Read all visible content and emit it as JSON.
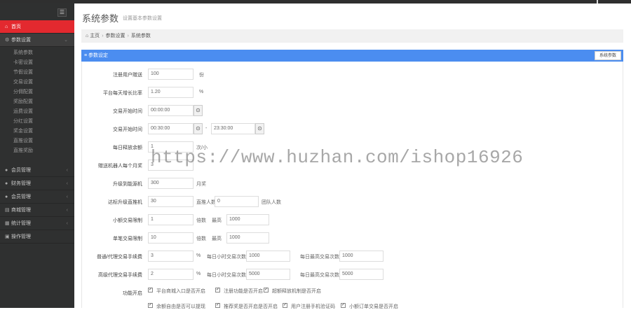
{
  "sidebar": {
    "toggle_icon": "menu-icon",
    "home": "首页",
    "params": "参数设置",
    "sub": [
      "系统参数",
      "卡密设置",
      "节假设置",
      "交易设置",
      "分佣配置",
      "奖励配置",
      "运费设置",
      "分红设置",
      "奖金设置",
      "直推设置",
      "直推奖励"
    ],
    "menus": [
      "会员管理",
      "财务管理",
      "会员管理",
      "商城管理",
      "统计管理",
      "操作管理"
    ]
  },
  "page": {
    "title": "系统参数",
    "subtitle": "设置基本参数设置"
  },
  "breadcrumb": {
    "home": "主页",
    "section": "参数设置",
    "current": "系统参数"
  },
  "panel": {
    "title": "≡ 参数设定",
    "back": "系统参数"
  },
  "form": {
    "r1": {
      "label": "注册用户赠送",
      "value": "100",
      "unit": "份"
    },
    "r2": {
      "label": "平台每天增长比率",
      "value": "1.20",
      "unit": "%"
    },
    "r3": {
      "label": "交易开始时间",
      "value": "00:00:00"
    },
    "r4": {
      "label": "交易开始时间",
      "start": "00:30:00",
      "dash": "-",
      "end": "23:30:00"
    },
    "r5": {
      "label": "每日释放余额",
      "value": "1",
      "unit": "次/小"
    },
    "r6": {
      "label": "赠送机器人每个月奖",
      "value": "3",
      "unit": ""
    },
    "r7": {
      "label": "升级到能源机",
      "value": "300",
      "unit": "月奖"
    },
    "r8": {
      "label": "达标升级直推机",
      "value": "30",
      "unit1": "直推人数",
      "value2": "0",
      "unit2": "团队人数"
    },
    "r9": {
      "label": "小额交易限制",
      "value": "1",
      "unit1": "倍数",
      "mid": "最高",
      "value2": "1000"
    },
    "r10": {
      "label": "单笔交易限制",
      "value": "10",
      "unit1": "倍数",
      "mid": "最高",
      "value2": "1000"
    },
    "r11": {
      "label": "普通/代理交易手续费",
      "value": "3",
      "unit": "%",
      "l2": "每日小时交易次数",
      "v2": "1000",
      "l3": "每日最高交易次数",
      "v3": "1000"
    },
    "r12": {
      "label": "高级代理交易手续费",
      "value": "2",
      "unit": "%",
      "l2": "每日小时交易次数",
      "v2": "5000",
      "l3": "每日最高交易次数",
      "v3": "5000"
    },
    "r13": {
      "label": "功能开启",
      "opts": [
        "平台商城入口是否开启",
        "注册功能是否开启",
        "超额释放机制是否开启"
      ]
    },
    "r14": {
      "opts": [
        "余额自由是否可以提现",
        "推荐奖是否开启是否开启",
        "用户注册手机验证码",
        "小额订单交易是否开启"
      ]
    }
  },
  "watermark": "https://www.huzhan.com/ishop16926"
}
